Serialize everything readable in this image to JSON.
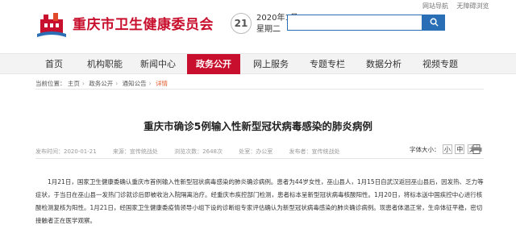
{
  "site": {
    "title": "重庆市卫生健康委员会",
    "date_day": "21",
    "date_line1": "2020年1月",
    "date_line2": "星期二",
    "top_links": [
      "网站导航",
      "无障碍浏览"
    ],
    "search_button": "搜索"
  },
  "nav": {
    "items": [
      {
        "label": "首页"
      },
      {
        "label": "机构职能"
      },
      {
        "label": "新闻中心"
      },
      {
        "label": "政务公开"
      },
      {
        "label": "网上服务"
      },
      {
        "label": "专题专栏"
      },
      {
        "label": "数据分析"
      },
      {
        "label": "视频专题"
      }
    ],
    "active_index": 3
  },
  "breadcrumb": {
    "prefix": "当前位置：",
    "items": [
      "主页",
      "政务公开",
      "通知公告",
      "详情"
    ]
  },
  "article": {
    "title": "重庆市确诊5例输入性新型冠状病毒感染的肺炎病例",
    "meta": {
      "date": "发布时间：2020-01-21",
      "source": "来源：宣传统战处",
      "views": "浏览次数：2648次",
      "office": "处室：办公室",
      "author": "发布者：宣传统战处"
    },
    "font_size_label": "字体大小：",
    "font_sizes": [
      "小",
      "中",
      "大"
    ],
    "body": "1月21日，国家卫生健康委确认重庆市首例输入性新型冠状病毒感染的肺炎确诊病例。患者为44岁女性，巫山县人，1月15日自武汉返回巫山县后，因发热、乏力等症状，于当日在巫山县一发热门诊就诊后即被收治入院隔离治疗。经重庆市疾控部门检测，患者标本呈新型冠状病毒核酸阳性。1月20日，将标本送中国疾控中心进行核酸检测复核为阳性。1月21日，经国家卫生健康委疫情领导小组下设的诊断组专家评估确认为新型冠状病毒感染的肺炎确诊病例。现患者体温正常，生命体征平稳，密切接触者正在医学观察。"
  },
  "colors": {
    "brand_red": "#c8102e",
    "nav_bg": "#f3f3f3",
    "search_blue": "#2a6fb5",
    "breadcrumb_current": "#e05a2a"
  }
}
